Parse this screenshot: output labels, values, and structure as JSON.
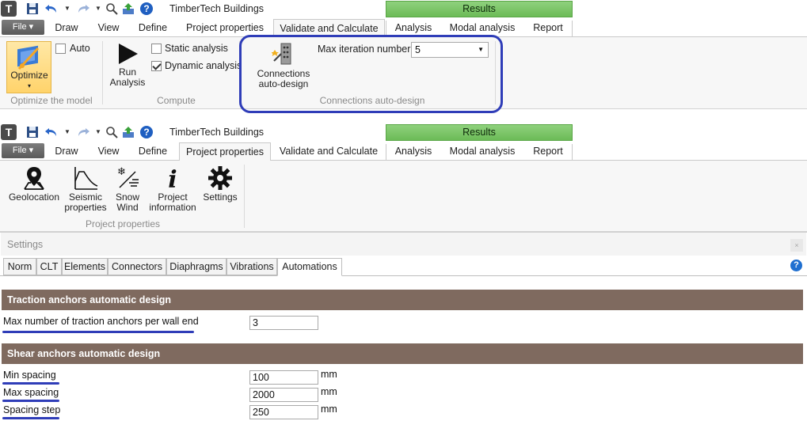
{
  "window": {
    "app_logo": "T",
    "title": "TimberTech Buildings",
    "results_label": "Results"
  },
  "tabs": {
    "file": "File ▾",
    "items": [
      "Draw",
      "View",
      "Define",
      "Project properties",
      "Validate and Calculate",
      "Analysis",
      "Modal analysis",
      "Report"
    ]
  },
  "ribbon_validate": {
    "optimize_label": "Optimize",
    "optimize_arrow": "▾",
    "auto_label": "Auto",
    "auto_checked": false,
    "group_optimize": "Optimize the model",
    "run_analysis_line1": "Run",
    "run_analysis_line2": "Analysis",
    "static_analysis_label": "Static analysis",
    "static_analysis_checked": false,
    "dynamic_analysis_label": "Dynamic analysis",
    "dynamic_analysis_checked": true,
    "group_compute": "Compute",
    "connections_line1": "Connections",
    "connections_line2": "auto-design",
    "max_iteration_label": "Max iteration number",
    "max_iteration_value": "5",
    "group_connections": "Connections auto-design"
  },
  "ribbon_project": {
    "geolocation": "Geolocation",
    "seismic_line1": "Seismic",
    "seismic_line2": "properties",
    "snow_line1": "Snow",
    "snow_line2": "Wind",
    "project_info_line1": "Project",
    "project_info_line2": "information",
    "settings": "Settings",
    "group_label": "Project properties"
  },
  "settings_panel": {
    "title": "Settings",
    "close": "×",
    "help": "?",
    "tabs": [
      "Norm",
      "CLT",
      "Elements",
      "Connectors",
      "Diaphragms",
      "Vibrations",
      "Automations"
    ],
    "active_tab": "Automations",
    "traction_section": "Traction anchors automatic design",
    "max_traction_label": "Max number of traction anchors per wall end",
    "max_traction_value": "3",
    "shear_section": "Shear anchors automatic design",
    "min_spacing_label": "Min spacing",
    "min_spacing_value": "100",
    "max_spacing_label": "Max spacing",
    "max_spacing_value": "2000",
    "spacing_step_label": "Spacing step",
    "spacing_step_value": "250",
    "unit": "mm"
  },
  "colors": {
    "results_green": "#6cbb57",
    "section_band": "#7f6a5f",
    "highlight_blue": "#2f3db8"
  }
}
